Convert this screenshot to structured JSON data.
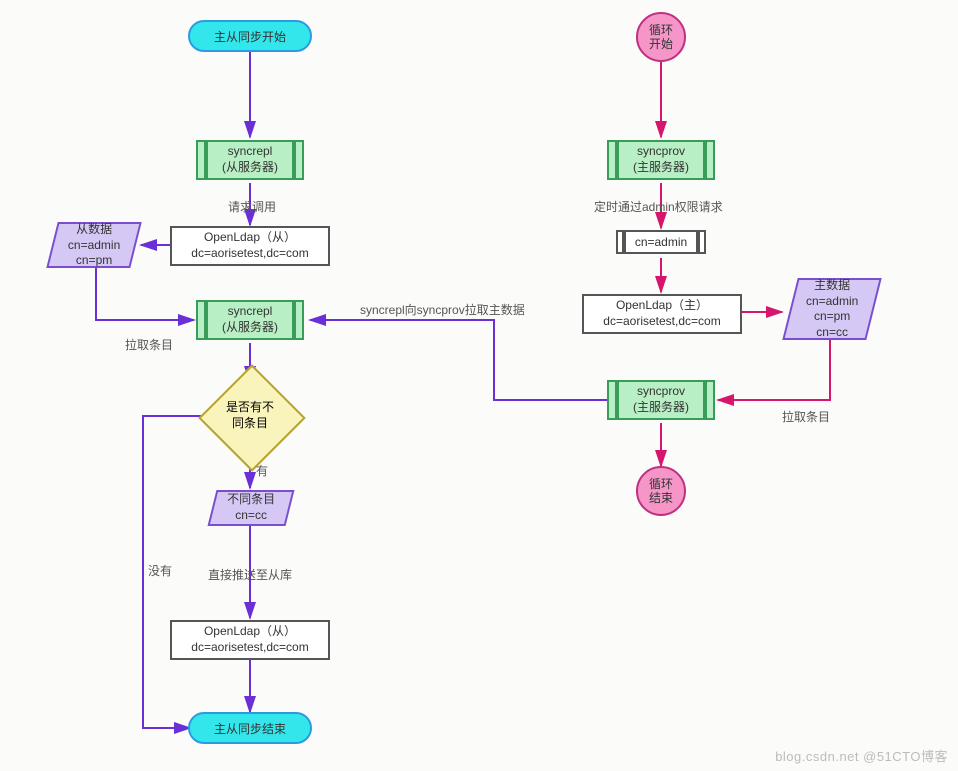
{
  "left": {
    "start": "主从同步开始",
    "syncrepl1_l1": "syncrepl",
    "syncrepl1_l2": "(从服务器)",
    "edge_request": "请求调用",
    "openldap1_l1": "OpenLdap（从）",
    "openldap1_l2": "dc=aorisetest,dc=com",
    "data_slave_l1": "从数据",
    "data_slave_l2": "cn=admin",
    "data_slave_l3": "cn=pm",
    "edge_pull": "拉取条目",
    "syncrepl2_l1": "syncrepl",
    "syncrepl2_l2": "(从服务器)",
    "decision_l1": "是否有不",
    "decision_l2": "同条目",
    "edge_yes": "有",
    "edge_no": "没有",
    "diff_l1": "不同条目",
    "diff_l2": "cn=cc",
    "edge_push": "直接推送至从库",
    "openldap2_l1": "OpenLdap（从）",
    "openldap2_l2": "dc=aorisetest,dc=com",
    "end": "主从同步结束"
  },
  "mid": {
    "edge_cross": "syncrepl向syncprov拉取主数据"
  },
  "right": {
    "loop_start_l1": "循环",
    "loop_start_l2": "开始",
    "syncprov1_l1": "syncprov",
    "syncprov1_l2": "(主服务器)",
    "edge_timer": "定时通过admin权限请求",
    "cn_admin": "cn=admin",
    "openldap_l1": "OpenLdap（主）",
    "openldap_l2": "dc=aorisetest,dc=com",
    "data_master_l1": "主数据",
    "data_master_l2": "cn=admin",
    "data_master_l3": "cn=pm",
    "data_master_l4": "cn=cc",
    "edge_pull": "拉取条目",
    "syncprov2_l1": "syncprov",
    "syncprov2_l2": "(主服务器)",
    "loop_end_l1": "循环",
    "loop_end_l2": "结束"
  },
  "watermark": "blog.csdn.net  @51CTO博客"
}
